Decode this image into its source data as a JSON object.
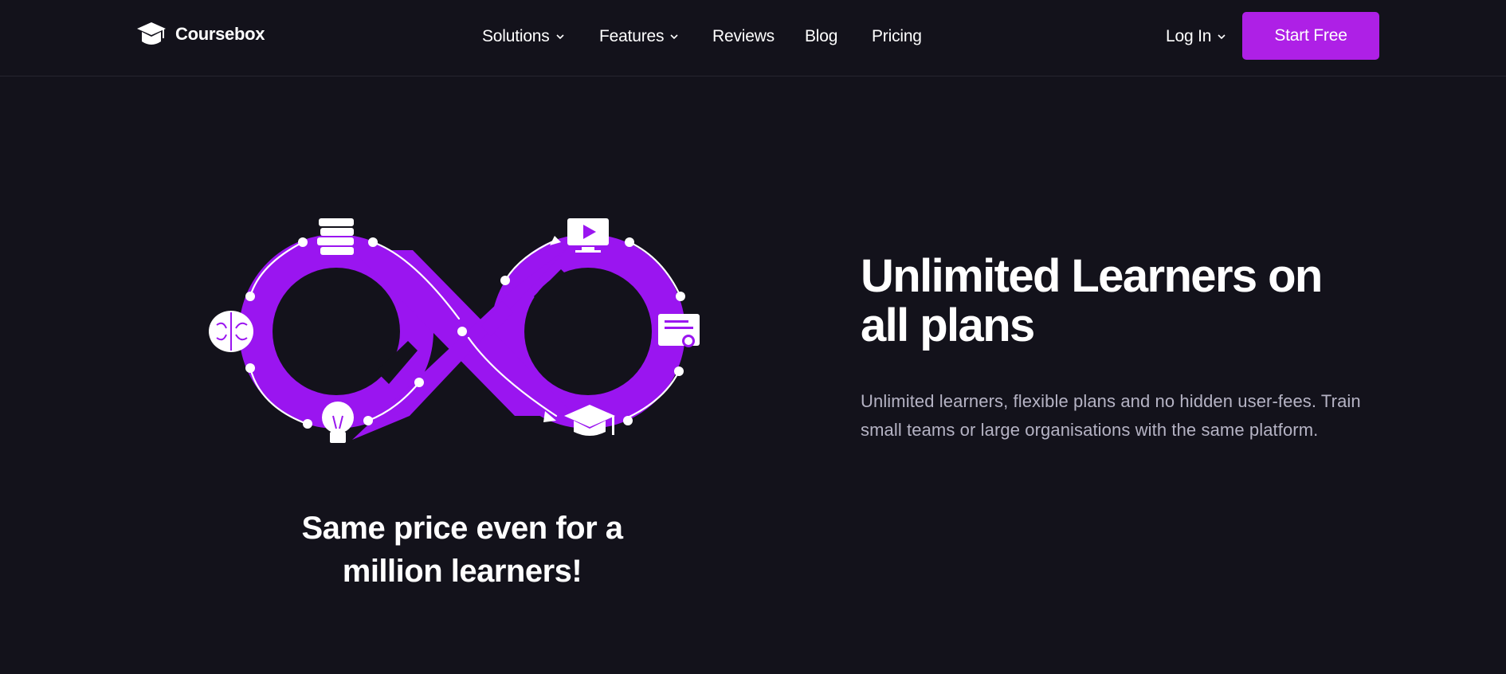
{
  "header": {
    "brand": "Coursebox",
    "nav": [
      {
        "label": "Solutions",
        "has_dropdown": true
      },
      {
        "label": "Features",
        "has_dropdown": true
      },
      {
        "label": "Reviews",
        "has_dropdown": false
      },
      {
        "label": "Blog",
        "has_dropdown": false
      },
      {
        "label": "Pricing",
        "has_dropdown": false
      }
    ],
    "login": {
      "label": "Log In",
      "has_dropdown": true
    },
    "cta": "Start Free"
  },
  "hero": {
    "illustration_caption": "Same price even for a million learners!",
    "title": "Unlimited Learners on all plans",
    "description": "Unlimited learners, flexible plans and no hidden user-fees. Train small teams or large organisations with the same platform.",
    "icons": [
      "books-icon",
      "video-play-icon",
      "certificate-icon",
      "graduation-cap-icon",
      "lightbulb-icon",
      "brain-icon"
    ]
  },
  "colors": {
    "background": "#13121b",
    "accent": "#ae20e6",
    "infinity": "#9a15f0",
    "text": "#ffffff",
    "muted_text": "#b5b3c4"
  }
}
